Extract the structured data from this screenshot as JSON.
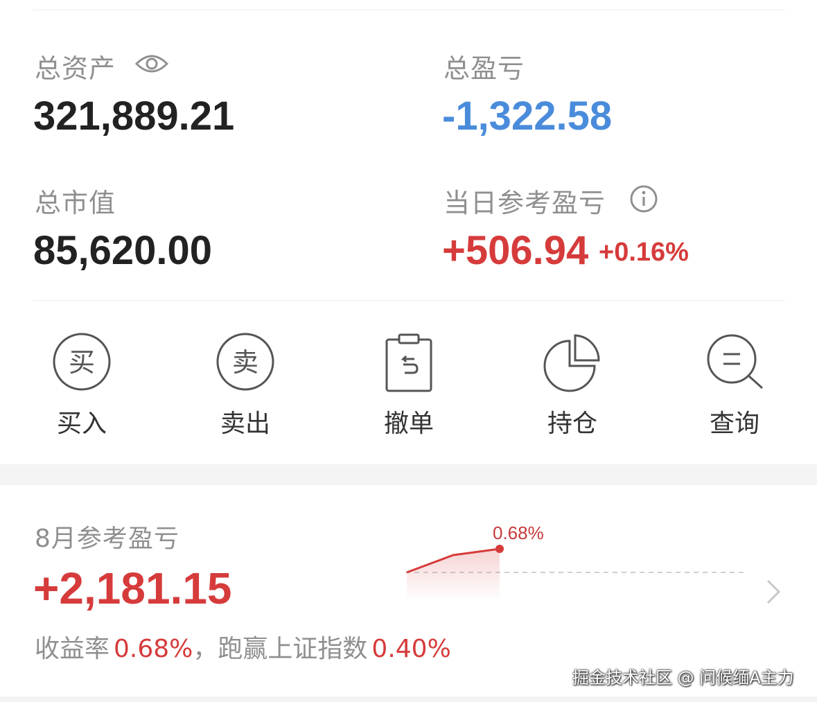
{
  "summary": {
    "total_assets_label": "总资产",
    "total_assets_value": "321,889.21",
    "total_pnl_label": "总盈亏",
    "total_pnl_value": "-1,322.58",
    "market_value_label": "总市值",
    "market_value_value": "85,620.00",
    "daily_pnl_label": "当日参考盈亏",
    "daily_pnl_value": "+506.94",
    "daily_pnl_percent": "+0.16%"
  },
  "actions": [
    {
      "label": "买入",
      "icon_glyph": "买",
      "icon": "buy-icon"
    },
    {
      "label": "卖出",
      "icon_glyph": "卖",
      "icon": "sell-icon"
    },
    {
      "label": "撤单",
      "icon": "cancel-order-icon"
    },
    {
      "label": "持仓",
      "icon": "pie-chart-icon"
    },
    {
      "label": "查询",
      "icon": "search-icon"
    }
  ],
  "monthly": {
    "title": "8月参考盈亏",
    "value": "+2,181.15",
    "yield_label": "收益率",
    "yield_value": "0.68%",
    "separator": "，",
    "benchmark_label": "跑赢上证指数",
    "benchmark_value": "0.40%",
    "chart_label": "0.68%"
  },
  "chart_data": {
    "type": "area",
    "x": [
      0,
      1,
      2
    ],
    "values": [
      0.0,
      0.5,
      0.68
    ],
    "labels": [
      "0.68%"
    ]
  },
  "watermark": "掘金技术社区 @ 问候缅A主力",
  "colors": {
    "up": "#d63b3b",
    "down": "#4a8cdb",
    "text_dark": "#222222",
    "text_gray": "#8f8f8f"
  }
}
